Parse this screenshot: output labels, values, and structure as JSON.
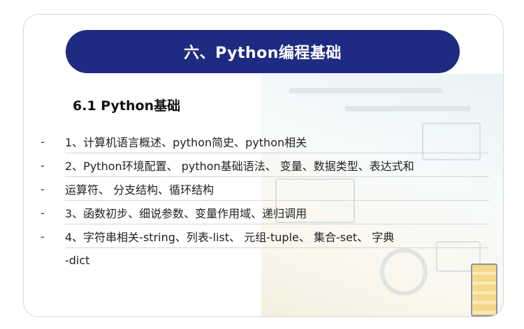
{
  "slide": {
    "title": "六、Python编程基础",
    "section": "6.1 Python基础",
    "items": [
      {
        "marker": "-",
        "text": "1、计算机语言概述、python简史、python相关"
      },
      {
        "marker": "-",
        "text": "2、Python环境配置、 python基础语法、 变量、数据类型、表达式和"
      },
      {
        "marker": "-",
        "text": "运算符、 分支结构、循环结构"
      },
      {
        "marker": "-",
        "text": "3、函数初步、细说参数、变量作用域、递归调用"
      },
      {
        "marker": "-",
        "text": "4、字符串相关-string、列表-list、 元组-tuple、 集合-set、 字典"
      },
      {
        "marker": "",
        "text": "-dict"
      }
    ]
  },
  "colors": {
    "title_bar": "#1f2b82",
    "title_text": "#ffffff",
    "body_text": "#222222"
  }
}
